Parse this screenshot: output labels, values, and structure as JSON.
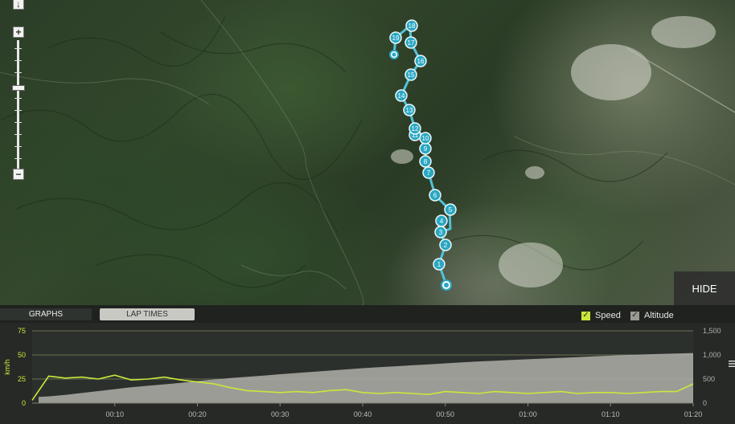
{
  "map": {
    "route_markers": [
      "1",
      "2",
      "3",
      "4",
      "5",
      "6",
      "7",
      "8",
      "9",
      "10",
      "11",
      "12",
      "13",
      "14",
      "15",
      "16",
      "17",
      "18",
      "19"
    ],
    "hide_label": "HIDE",
    "zoom_in_label": "+",
    "zoom_out_label": "−",
    "compass_label": "↓"
  },
  "tabs": [
    {
      "label": "GRAPHS",
      "active": true
    },
    {
      "label": "LAP TIMES",
      "active": false
    }
  ],
  "legend": {
    "speed": {
      "label": "Speed",
      "checked": true,
      "color": "#c8e83a"
    },
    "altitude": {
      "label": "Altitude",
      "checked": true,
      "color": "#9a9a94"
    }
  },
  "chart_data": {
    "type": "line",
    "x": [
      "00:00",
      "00:02",
      "00:04",
      "00:06",
      "00:08",
      "00:10",
      "00:12",
      "00:14",
      "00:16",
      "00:18",
      "00:20",
      "00:22",
      "00:24",
      "00:26",
      "00:28",
      "00:30",
      "00:32",
      "00:34",
      "00:36",
      "00:38",
      "00:40",
      "00:42",
      "00:44",
      "00:46",
      "00:48",
      "00:50",
      "00:52",
      "00:54",
      "00:56",
      "00:58",
      "01:00",
      "01:02",
      "01:04",
      "01:06",
      "01:08",
      "01:10",
      "01:12",
      "01:14",
      "01:16",
      "01:18",
      "01:20"
    ],
    "x_ticks": [
      "00:10",
      "00:20",
      "00:30",
      "00:40",
      "00:50",
      "01:00",
      "01:10",
      "01:20"
    ],
    "y_left": {
      "label": "km/h",
      "ticks": [
        "0",
        "25",
        "50",
        "75"
      ],
      "range": [
        0,
        75
      ]
    },
    "y_right": {
      "ticks": [
        "0",
        "500",
        "1,000",
        "1,500"
      ],
      "range": [
        0,
        1500
      ]
    },
    "series": [
      {
        "name": "Speed",
        "axis": "left",
        "color": "#c8e83a",
        "values": [
          3,
          28,
          26,
          27,
          25,
          29,
          24,
          25,
          27,
          24,
          22,
          20,
          16,
          13,
          12,
          11,
          12,
          11,
          13,
          14,
          11,
          10,
          11,
          10,
          9,
          12,
          11,
          10,
          12,
          11,
          10,
          11,
          12,
          10,
          11,
          11,
          10,
          11,
          12,
          12,
          20
        ]
      },
      {
        "name": "Altitude",
        "axis": "right",
        "color": "#a9a9a3",
        "values": [
          130,
          140,
          170,
          210,
          250,
          290,
          330,
          360,
          390,
          420,
          460,
          490,
          520,
          545,
          570,
          600,
          625,
          650,
          675,
          700,
          725,
          745,
          765,
          785,
          805,
          825,
          845,
          865,
          880,
          895,
          910,
          925,
          940,
          955,
          970,
          985,
          1000,
          1010,
          1020,
          1030,
          1040
        ]
      }
    ]
  }
}
